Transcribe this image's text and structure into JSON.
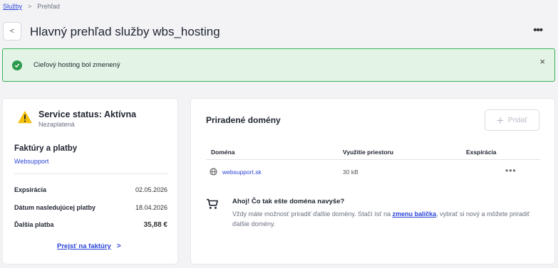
{
  "breadcrumb": {
    "root": "Služby",
    "separator": ">",
    "current": "Prehľad"
  },
  "header": {
    "title": "Hlavný prehľad služby wbs_hosting",
    "back_icon": "<",
    "more_icon": "•••"
  },
  "alert": {
    "message": "Cieľový hosting bol zmenený",
    "close": "×"
  },
  "status": {
    "title": "Service status: Aktívna",
    "subtitle": "Nezaplatená"
  },
  "billing": {
    "title": "Faktúry a platby",
    "link": "Websupport",
    "rows": [
      {
        "label": "Expsirácia",
        "value": "02.05.2026"
      },
      {
        "label": "Dátum nasledujúcej platby",
        "value": "18.04.2026"
      },
      {
        "label": "Ďalšia platba",
        "value": "35,88 €"
      }
    ],
    "goto": "Prejsť na faktúry",
    "goto_chevron": ">"
  },
  "domains": {
    "title": "Priradené domény",
    "add_label": "Pridať",
    "add_icon": "+",
    "columns": [
      "Doména",
      "Využitie priestoru",
      "Exspirácia"
    ],
    "rows": [
      {
        "domain": "websupport.sk",
        "usage": "30 kB",
        "expiry": "",
        "more": "•••"
      }
    ]
  },
  "promo": {
    "title": "Ahoj! Čo tak ešte doména navyše?",
    "text_before": "Vždy máte možnosť priradiť ďalšie domény. Stačí ísť na ",
    "link": "zmenu balíčka",
    "text_after": ", vybrať si nový a môžete priradiť ďalšie domény."
  },
  "colors": {
    "accent": "#2b44d6",
    "success": "#2c9a4c",
    "success_bg": "#e3f3e5",
    "warning": "#f4c20d"
  }
}
